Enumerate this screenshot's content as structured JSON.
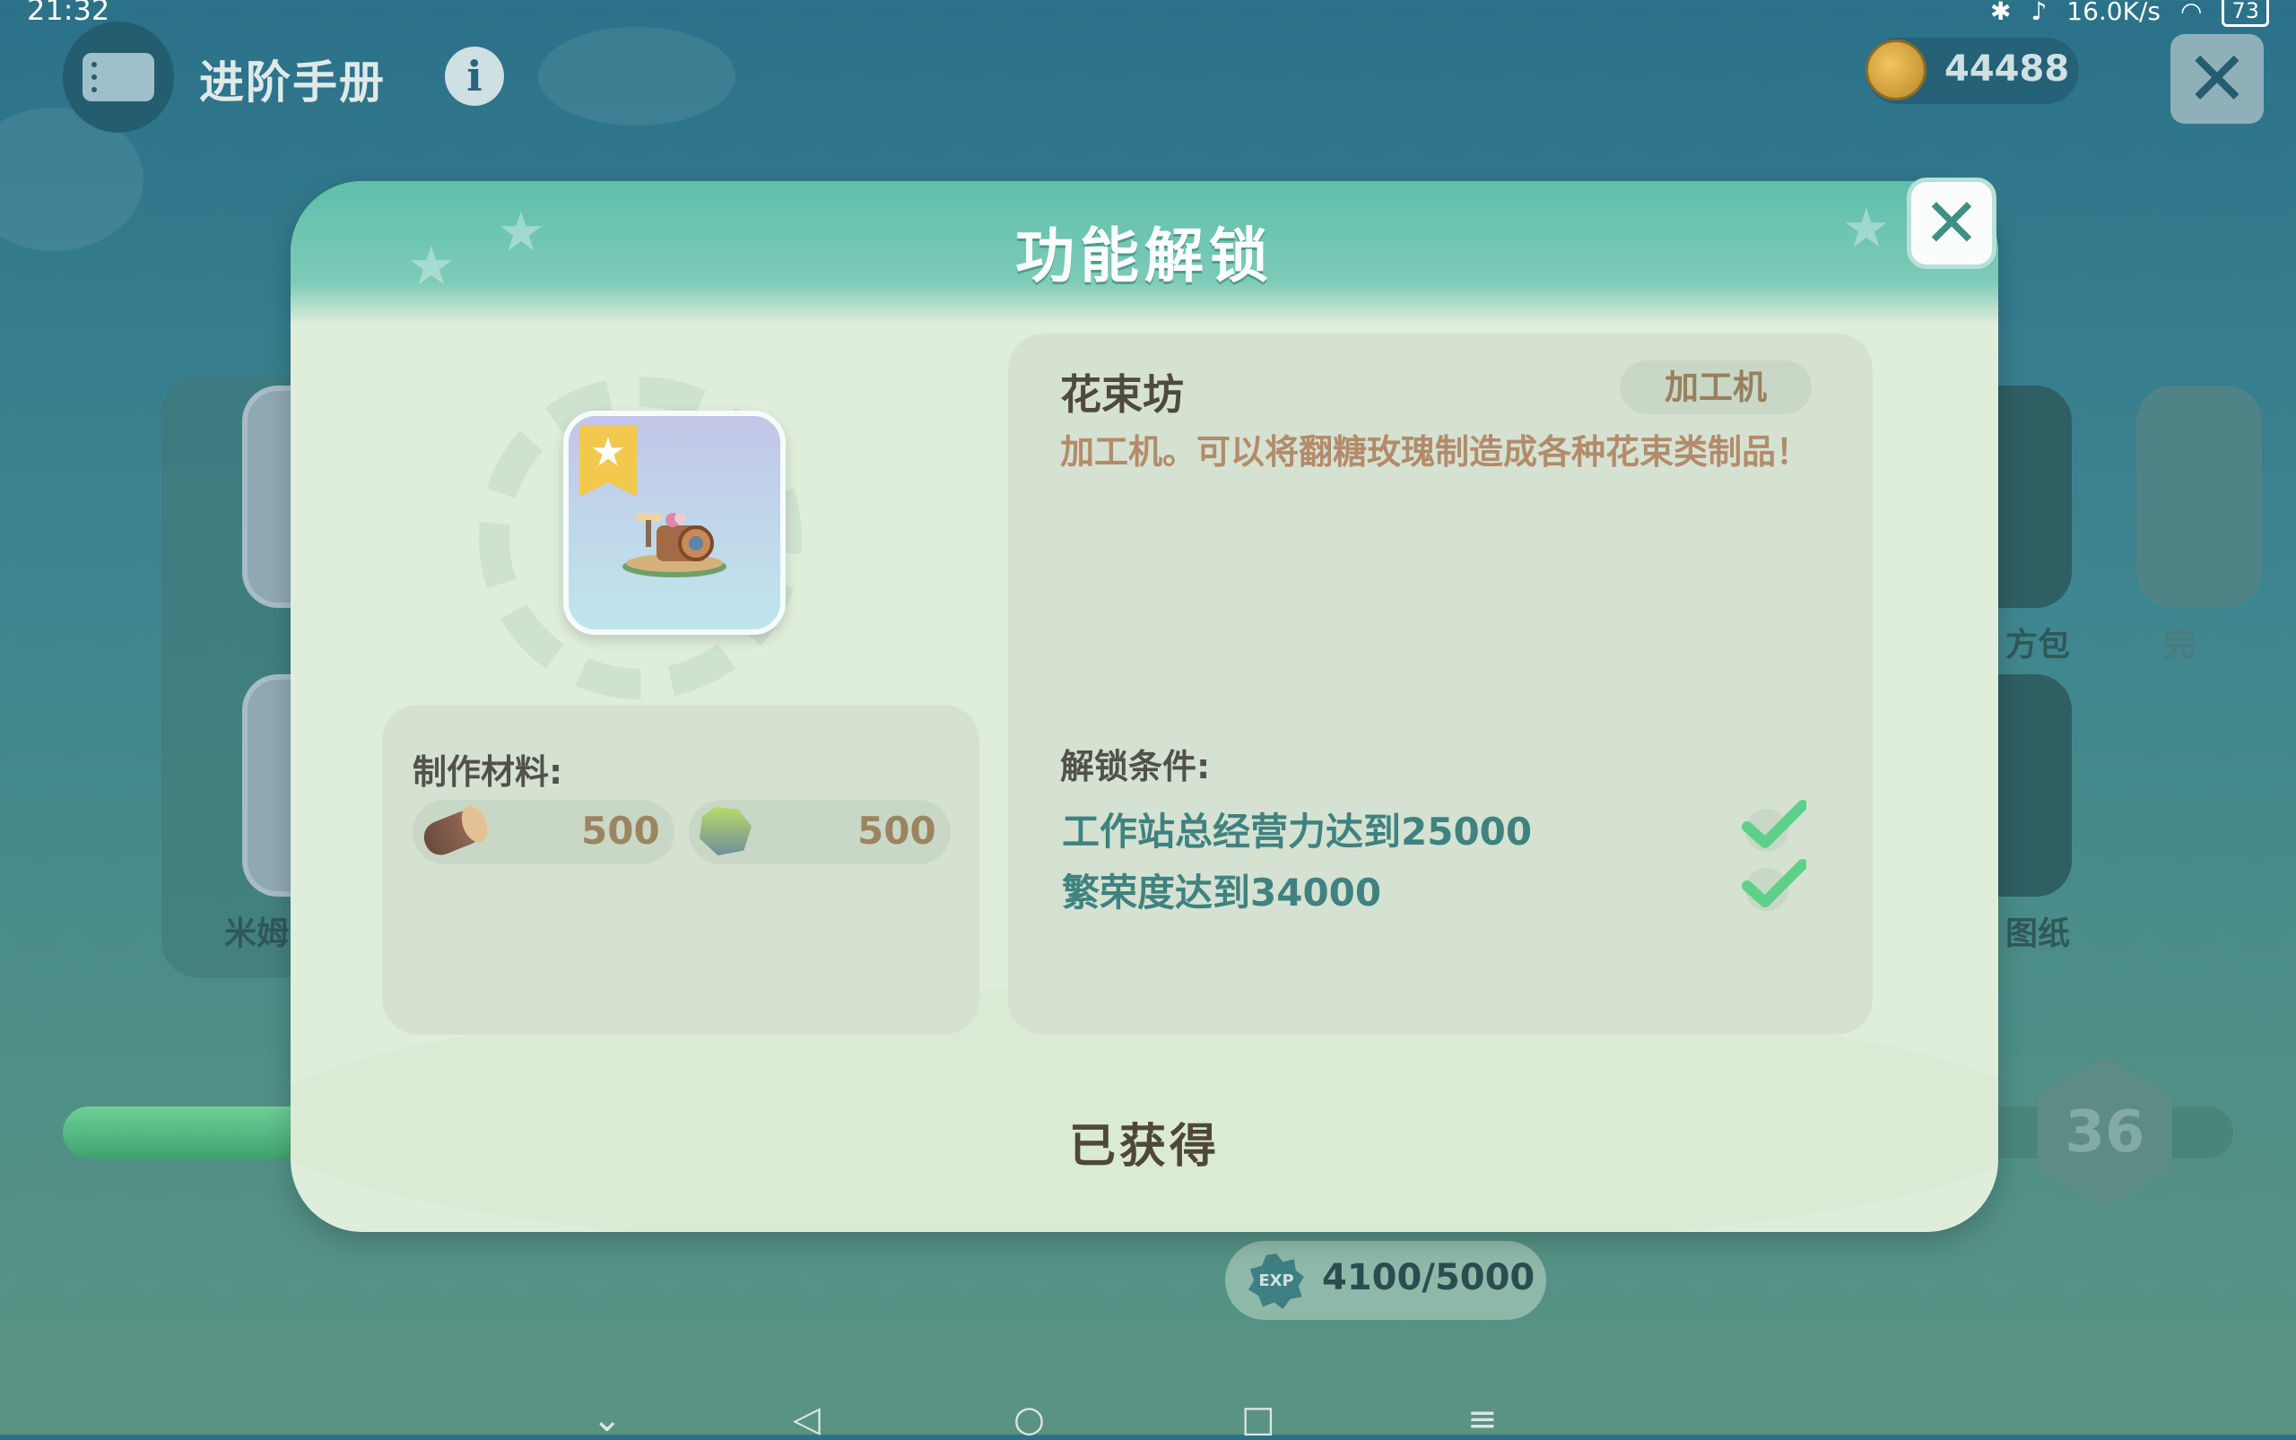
{
  "status_bar": {
    "time": "21:32",
    "network_speed": "16.0K/s",
    "battery": "73"
  },
  "header": {
    "title": "进阶手册",
    "info_label": "i",
    "coins": "44488",
    "close_label": "✕"
  },
  "background": {
    "card_labels": [
      "米姆",
      "方包",
      "图纸",
      "完"
    ],
    "level": "36",
    "exp": "4100/5000",
    "exp_badge": "EXP",
    "progress_fraction": 0.82
  },
  "modal": {
    "title": "功能解锁",
    "close_label": "✕",
    "item": {
      "name": "花束坊",
      "type": "加工机",
      "description": "加工机。可以将翻糖玫瑰制造成各种花束类制品！"
    },
    "materials": {
      "label": "制作材料:",
      "items": [
        {
          "icon": "wood-log-icon",
          "amount": "500"
        },
        {
          "icon": "stone-icon",
          "amount": "500"
        }
      ]
    },
    "conditions": {
      "label": "解锁条件:",
      "items": [
        {
          "text": "工作站总经营力达到25000",
          "met": true
        },
        {
          "text": "繁荣度达到34000",
          "met": true
        }
      ]
    },
    "status_text": "已获得"
  },
  "nav": {
    "items": [
      "⌄",
      "◁",
      "○",
      "□",
      "≡"
    ]
  },
  "colors": {
    "accent": "#5fbfac",
    "check": "#5fd08a",
    "modal_bg": "#dfeddb"
  }
}
